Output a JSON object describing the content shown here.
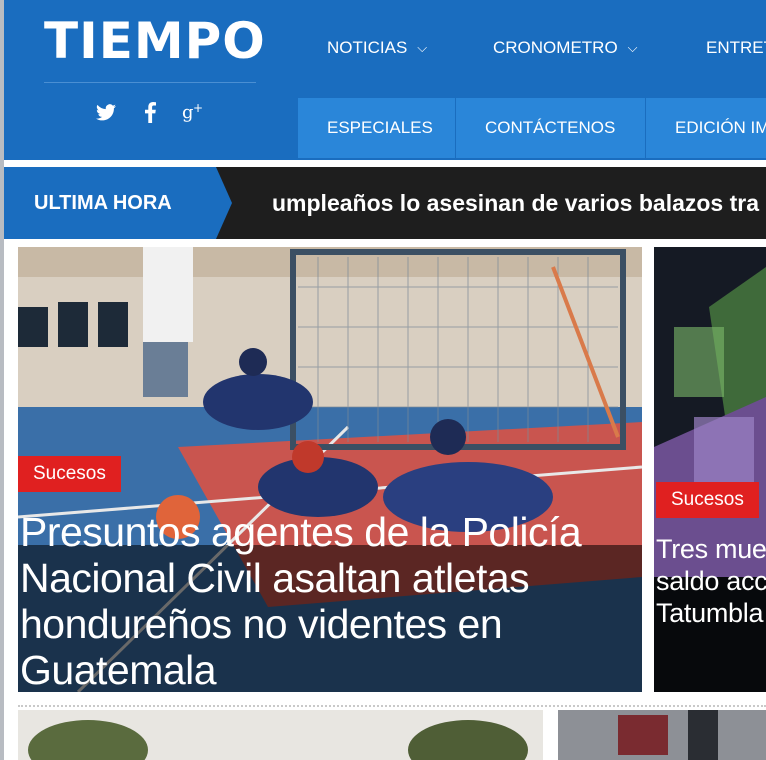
{
  "brand": {
    "logo": "TIEMPO",
    "accent": "#1a6dbf",
    "accent_light": "#2a86d9"
  },
  "social": [
    {
      "name": "twitter-icon"
    },
    {
      "name": "facebook-icon"
    },
    {
      "name": "google-plus-icon"
    }
  ],
  "nav_top": [
    {
      "label": "NOTICIAS",
      "has_dropdown": true
    },
    {
      "label": "CRONOMETRO",
      "has_dropdown": true
    },
    {
      "label": "ENTRET"
    }
  ],
  "nav_bottom": [
    {
      "label": "ESPECIALES"
    },
    {
      "label": "CONTÁCTENOS"
    },
    {
      "label": "EDICIÓN IM"
    }
  ],
  "ticker": {
    "label": "ULTIMA HORA",
    "text": "umpleaños lo asesinan de varios balazos tra"
  },
  "stories": {
    "main": {
      "tag": "Sucesos",
      "headline": "Presuntos agentes de la Policía Nacional Civil asaltan atletas hondureños no videntes en Guatemala"
    },
    "side": {
      "tag": "Sucesos",
      "headline": "Tres muertos es el saldo accidente Tatumbla Morazán"
    }
  },
  "colors": {
    "tag_red": "#e02020",
    "ticker_bg": "#1e1e1e"
  }
}
